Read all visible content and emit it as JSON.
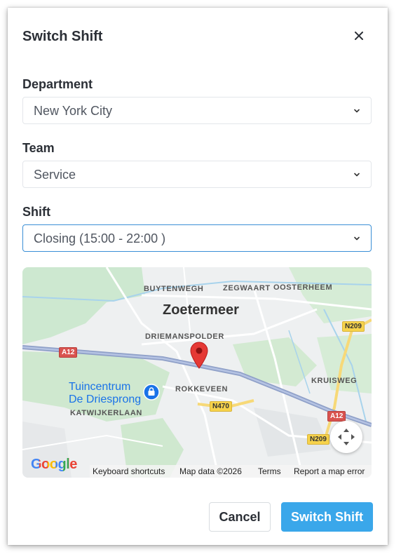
{
  "dialog": {
    "title": "Switch Shift",
    "close_icon": "close-icon"
  },
  "fields": {
    "department": {
      "label": "Department",
      "value": "New York City"
    },
    "team": {
      "label": "Team",
      "value": "Service"
    },
    "shift": {
      "label": "Shift",
      "value": "Closing (15:00 - 22:00 )"
    }
  },
  "map": {
    "city": "Zoetermeer",
    "districts": [
      "BUYTENWEGH",
      "ZEGWAART",
      "OOSTERHEEM",
      "DRIEMANSPOLDER",
      "ROKKEVEEN",
      "KATWIJKERLAAN",
      "KRUISWEG"
    ],
    "poi_line1": "Tuincentrum",
    "poi_line2": "De Driesprong",
    "roads": [
      "A12",
      "N209",
      "N470",
      "A12",
      "N209"
    ],
    "logo": "Google",
    "footer": {
      "shortcuts": "Keyboard shortcuts",
      "data": "Map data ©2026",
      "terms": "Terms",
      "report": "Report a map error"
    }
  },
  "actions": {
    "cancel": "Cancel",
    "submit": "Switch Shift"
  },
  "colors": {
    "primary": "#3aa7ea",
    "focus_border": "#3a8fd6",
    "pin": "#e53935"
  }
}
